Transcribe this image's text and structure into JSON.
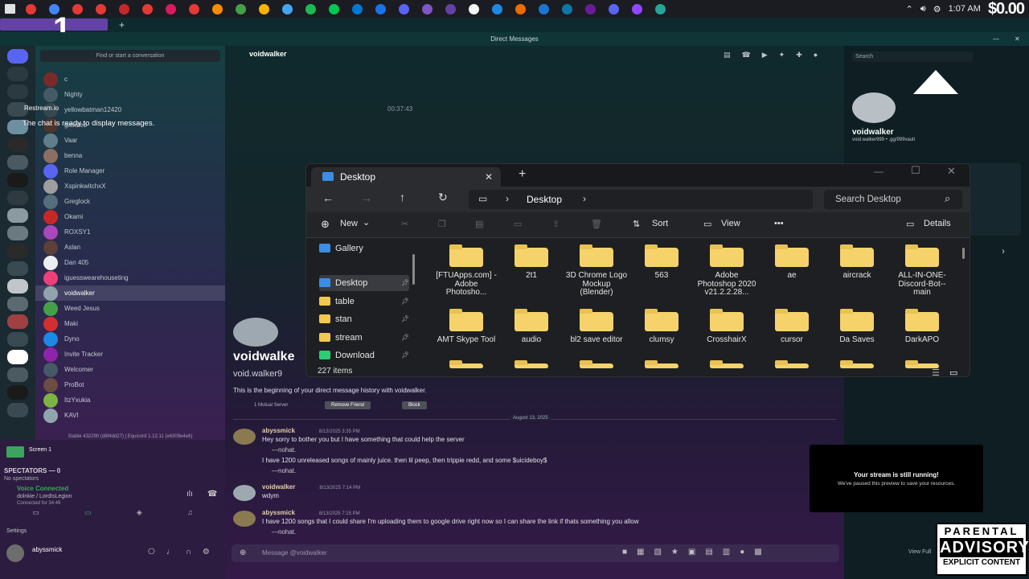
{
  "taskbar": {
    "icons": [
      "#e53935",
      "#4285f4",
      "#e53935",
      "#e53935",
      "#c62828",
      "#e53935",
      "#d81b60",
      "#e53935",
      "#fb8c00",
      "#43a047",
      "#ffb300",
      "#42a5f5",
      "#1db954",
      "#00c853",
      "#0078d4",
      "#1a73e8",
      "#5865f2",
      "#7e57c2",
      "#6441a5",
      "#f5f5f5",
      "#1e88e5",
      "#ef6c00",
      "#1976d2",
      "#0e76a8",
      "#6a1b9a",
      "#5865f2",
      "#9146ff",
      "#26a69a"
    ],
    "time": "1:07 AM",
    "money": "$0.00"
  },
  "stream": {
    "number": "1",
    "restream_label": "Restream.io",
    "chat_ready": "The chat is ready to display messages."
  },
  "discord": {
    "window_title": "Direct Messages",
    "search_placeholder": "Find or start a conversation",
    "dms": [
      {
        "name": "c",
        "color": "#7a2a2a"
      },
      {
        "name": "Nighty",
        "color": "#455a64"
      },
      {
        "name": "yellowbatman12420",
        "color": "#37474f"
      },
      {
        "name": "gasaieb",
        "color": "#4e342e"
      },
      {
        "name": "Vaar",
        "color": "#607d8b"
      },
      {
        "name": "benna",
        "color": "#8d6e63"
      },
      {
        "name": "Role Manager",
        "color": "#5865f2"
      },
      {
        "name": "XspinkwitchxX",
        "color": "#9e9e9e"
      },
      {
        "name": "Greglock",
        "color": "#546e7a"
      },
      {
        "name": "Okami",
        "color": "#c62828"
      },
      {
        "name": "ROXSY1",
        "color": "#ab47bc"
      },
      {
        "name": "Aslan",
        "color": "#5d4037"
      },
      {
        "name": "Dan 405",
        "color": "#eceff1"
      },
      {
        "name": "iguesswearehouseting",
        "color": "#ec407a"
      },
      {
        "name": "voidwalker",
        "color": "#90a4ae"
      },
      {
        "name": "Weed Jesus",
        "color": "#43a047"
      },
      {
        "name": "Maki",
        "color": "#d32f2f"
      },
      {
        "name": "Dyno",
        "color": "#1e88e5"
      },
      {
        "name": "Invite Tracker",
        "color": "#8e24aa"
      },
      {
        "name": "Welcomer",
        "color": "#455a64"
      },
      {
        "name": "ProBot",
        "color": "#6d4c41"
      },
      {
        "name": "ItzYxukia",
        "color": "#7cb342"
      },
      {
        "name": "KAVI",
        "color": "#90a4ae"
      }
    ],
    "build_info": "Stable 432290 (d8f4dd27) | Equicord 1.12.11 (e6309e4e6)",
    "screen_share": "Screen 1",
    "spectators": "SPECTATORS — 0",
    "no_spectators": "No spectators",
    "voice_connected": "Voice Connected",
    "voice_channel": "dolnkie / LordIsLegion",
    "connected_for": "Connected for 34:49",
    "settings_label": "Settings",
    "username": "abyssmick",
    "chat_header": "voidwalker",
    "timestamp": "00:37:43",
    "profile_big_name": "voidwalke",
    "profile_big_handle": "void.walker9",
    "history_note": "This is the beginning of your direct message history with voidwalker.",
    "mutual_server": "1 Mutual Server",
    "remove_friend": "Remove Friend",
    "block": "Block",
    "date_divider": "August 13, 2025",
    "messages": [
      {
        "author": "abyssmick",
        "time": "8/13/2025 3:35 PM",
        "lines": [
          "Hey sorry to bother you but I have something that could help the server",
          "—nohat.",
          "I have 1200 unreleased songs of mainly juice. then lil peep, then trippie redd, and some $uicideboy$",
          "—nohat."
        ]
      },
      {
        "author": "voidwalker",
        "time": "8/13/2025 7:14 PM",
        "lines": [
          "wdym"
        ]
      },
      {
        "author": "abyssmick",
        "time": "8/13/2025 7:15 PM",
        "lines": [
          "I have 1200 songs that I could share I'm uploading them to google drive right now so I can share the link if thats something you allow",
          "—nohat."
        ]
      }
    ],
    "message_placeholder": "Message @voidwalker",
    "profile_name": "voidwalker",
    "profile_handle": "void.walker999 • .gg/999vault",
    "search_label": "Search"
  },
  "explorer": {
    "tab_title": "Desktop",
    "breadcrumb": "Desktop",
    "search_placeholder": "Search Desktop",
    "new_label": "New",
    "sort_label": "Sort",
    "view_label": "View",
    "more_label": "•••",
    "details_label": "Details",
    "sidebar": [
      "Gallery",
      "Desktop",
      "table",
      "stan",
      "stream",
      "Download"
    ],
    "items": [
      "[FTUApps.com] - Adobe Photosho...",
      "2t1",
      "3D Chrome Logo Mockup (Blender)",
      "563",
      "Adobe Photoshop 2020 v21.2.2.28...",
      "ae",
      "aircrack",
      "ALL-IN-ONE-Discord-Bot--main",
      "AMT Skype Tool",
      "audio",
      "bl2 save editor",
      "clumsy",
      "CrosshairX",
      "cursor",
      "Da Saves",
      "DarkAPO"
    ],
    "item_count": "227 items"
  },
  "overlay": {
    "stream_title": "Your stream is still running!",
    "stream_sub": "We've paused this preview to save your resources.",
    "view_full": "View Full",
    "pa_line1": "PARENTAL",
    "pa_line2": "ADVISORY",
    "pa_line3": "EXPLICIT CONTENT"
  }
}
